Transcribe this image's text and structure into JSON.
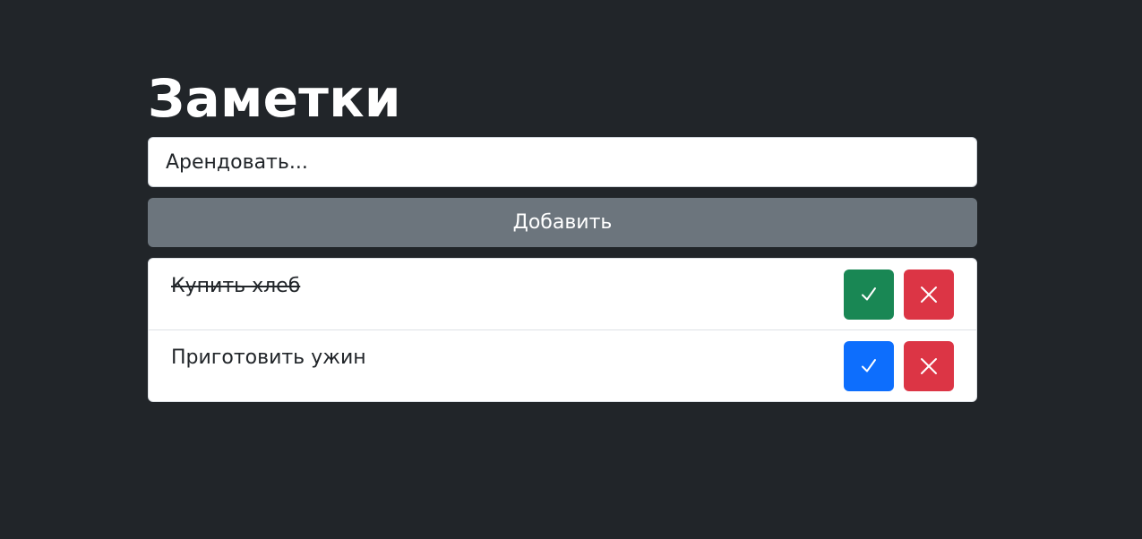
{
  "page": {
    "title": "Заметки"
  },
  "form": {
    "input_value": "Арендовать...",
    "add_label": "Добавить"
  },
  "notes": [
    {
      "text": "Купить хлеб",
      "completed": true,
      "check_icon": "checkmark-icon",
      "delete_icon": "close-icon",
      "check_color": "#198754"
    },
    {
      "text": "Приготовить ужин",
      "completed": false,
      "check_icon": "checkmark-icon",
      "delete_icon": "close-icon",
      "check_color": "#0d6efd"
    }
  ],
  "colors": {
    "background": "#212529",
    "secondary": "#6c757d",
    "success": "#198754",
    "primary": "#0d6efd",
    "danger": "#dc3545"
  }
}
